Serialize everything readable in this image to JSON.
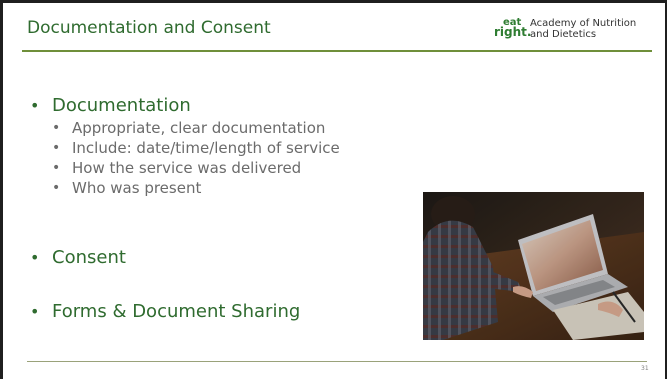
{
  "slide": {
    "title": "Documentation and Consent",
    "page_number": "31"
  },
  "logo": {
    "mark_top": "eat",
    "mark_bottom": "right.",
    "org_line1": "Academy of Nutrition",
    "org_line2": "and Dietetics",
    "color": "#2f7d32"
  },
  "bullets": {
    "documentation": {
      "label": "Documentation",
      "sub_items": [
        "Appropriate, clear documentation",
        "Include: date/time/length of service",
        "How the service was delivered",
        "Who was present"
      ]
    },
    "consent": {
      "label": "Consent"
    },
    "forms": {
      "label": "Forms & Document Sharing"
    }
  },
  "colors": {
    "heading_green": "#2f6b2f",
    "subtext_gray": "#6b6b6b",
    "rule_olive": "#6f8f3a"
  },
  "icons": {
    "bullet": "bullet-dot",
    "photo": "laptop-writing-photo"
  }
}
